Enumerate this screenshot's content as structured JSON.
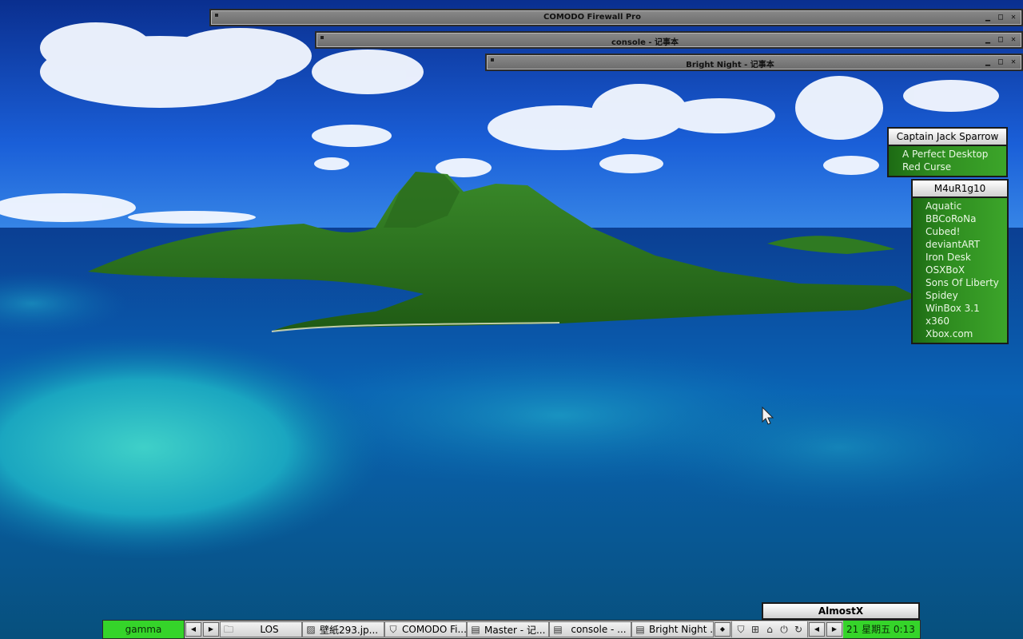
{
  "windows": [
    {
      "title": "COMODO Firewall Pro",
      "minimize": "▁",
      "maximize": "□",
      "close": "✕"
    },
    {
      "title": "console - 记事本",
      "minimize": "▁",
      "maximize": "□",
      "close": "✕"
    },
    {
      "title": "Bright Night - 记事本",
      "minimize": "▁",
      "maximize": "□",
      "close": "✕"
    }
  ],
  "menus": {
    "captain": {
      "title": "Captain Jack Sparrow",
      "items": [
        "A Perfect Desktop",
        "Red Curse"
      ]
    },
    "maurigio": {
      "title": "M4uR1g10",
      "items": [
        "Aquatic",
        "BBCoRoNa",
        "Cubed!",
        "deviantART",
        "Iron Desk",
        "OSXBoX",
        "Sons Of Liberty",
        "Spidey",
        "WinBox 3.1",
        "x360",
        "Xbox.com"
      ]
    }
  },
  "almostx": "AlmostX",
  "taskbar": {
    "workspace": "gamma",
    "prev_arrow": "◀",
    "next_arrow": "▶",
    "tasks": [
      {
        "label": "LOS",
        "icon": "folder-icon"
      },
      {
        "label": "壁紙293.jp...",
        "icon": "image-icon"
      },
      {
        "label": "COMODO Fi...",
        "icon": "shield-icon"
      },
      {
        "label": "Master - 记...",
        "icon": "notepad-icon"
      },
      {
        "label": "console - ...",
        "icon": "notepad-icon"
      },
      {
        "label": "Bright Night ...",
        "icon": "notepad-icon"
      }
    ],
    "tray_arrow": "◆",
    "tray_icons": [
      "shield-icon",
      "network-icon",
      "mouse-icon",
      "power-icon",
      "update-icon"
    ],
    "clock": "21 星期五 0:13"
  },
  "colors": {
    "menu_green": "#2f8d20",
    "workspace_green": "#35d42a",
    "sky_blue": "#0a4fc0",
    "lagoon": "#1aa6c8"
  }
}
